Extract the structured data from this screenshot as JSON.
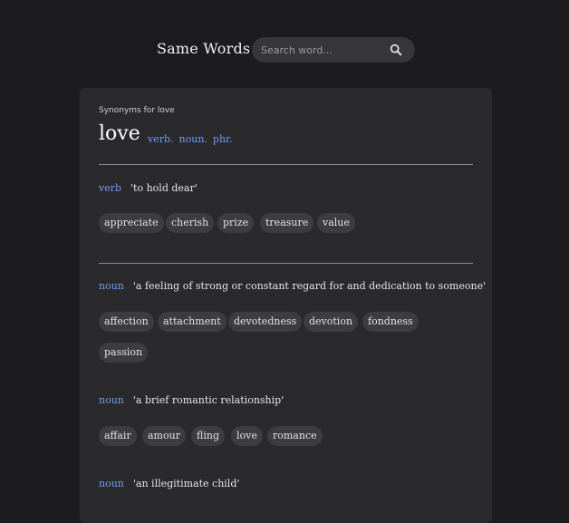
{
  "header": {
    "brand": "Same Words",
    "search_placeholder": "Search word...",
    "search_value": ""
  },
  "entry": {
    "subtitle": "Synonyms for love",
    "word": "love",
    "pos_links": [
      "verb.",
      "noun.",
      "phr."
    ]
  },
  "senses": [
    {
      "pos": "verb",
      "definition": "'to hold dear'",
      "synonyms": [
        "appreciate",
        "cherish",
        "prize",
        "treasure",
        "value"
      ]
    },
    {
      "pos": "noun",
      "definition": "'a feeling of strong or constant regard for and dedication to someone'",
      "synonyms": [
        "affection",
        "attachment",
        "devotedness",
        "devotion",
        "fondness",
        "passion"
      ]
    },
    {
      "pos": "noun",
      "definition": "'a brief romantic relationship'",
      "synonyms": [
        "affair",
        "amour",
        "fling",
        "love",
        "romance"
      ]
    },
    {
      "pos": "noun",
      "definition": "'an illegitimate child'",
      "synonyms": []
    }
  ],
  "colors": {
    "background": "#1c1c1e",
    "card": "#2a2a2d",
    "accent": "#6f9cf0",
    "chip": "#3d3d41"
  },
  "icons": {
    "search": "search-icon"
  }
}
